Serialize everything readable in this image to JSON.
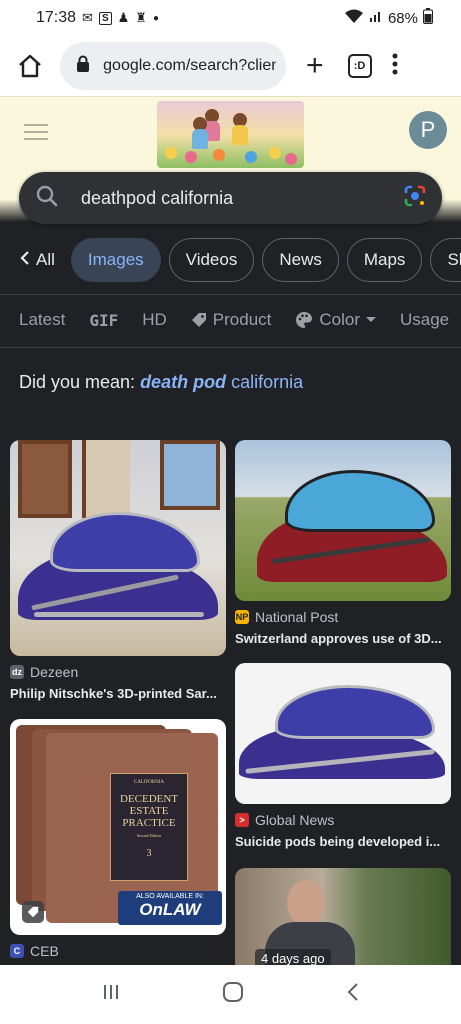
{
  "status_bar": {
    "time": "17:38",
    "notification_icons": [
      "mail-icon",
      "s-app-icon",
      "figure-icon",
      "keyhole-icon",
      "dot-icon"
    ],
    "battery": "68%"
  },
  "browser": {
    "url": "google.com/search?client",
    "tab_count": ":D"
  },
  "header": {
    "avatar_letter": "P"
  },
  "search": {
    "query": "deathpod california"
  },
  "chips": {
    "back": "All",
    "items": [
      "Images",
      "Videos",
      "News",
      "Maps",
      "Sho"
    ],
    "active": "Images"
  },
  "filters": {
    "latest": "Latest",
    "gif": "GIF",
    "hd": "HD",
    "product": "Product",
    "color": "Color",
    "usage": "Usage"
  },
  "did_you_mean": {
    "prefix": "Did you mean: ",
    "emphasis": "death pod",
    "rest": " california"
  },
  "results": [
    {
      "source": "Dezeen",
      "title": "Philip Nitschke's 3D-printed Sar...",
      "fav_color": "#3c4043"
    },
    {
      "source": "National Post",
      "title": "Switzerland approves use of 3D...",
      "fav_color": "#f9b400"
    },
    {
      "source": "Global News",
      "title": "Suicide pods being developed i...",
      "fav_color": "#d32f2f"
    },
    {
      "source": "CEB",
      "title": "",
      "fav_color": "#3f51b5"
    }
  ],
  "book": {
    "series": "CALIFORNIA",
    "title_line1": "DECEDENT",
    "title_line2": "ESTATE",
    "title_line3": "PRACTICE",
    "edition": "Second Edition",
    "volume": "3",
    "also": "ALSO AVAILABLE IN:",
    "brand": "OnLAW"
  },
  "badges": {
    "time_ago": "4 days ago"
  }
}
